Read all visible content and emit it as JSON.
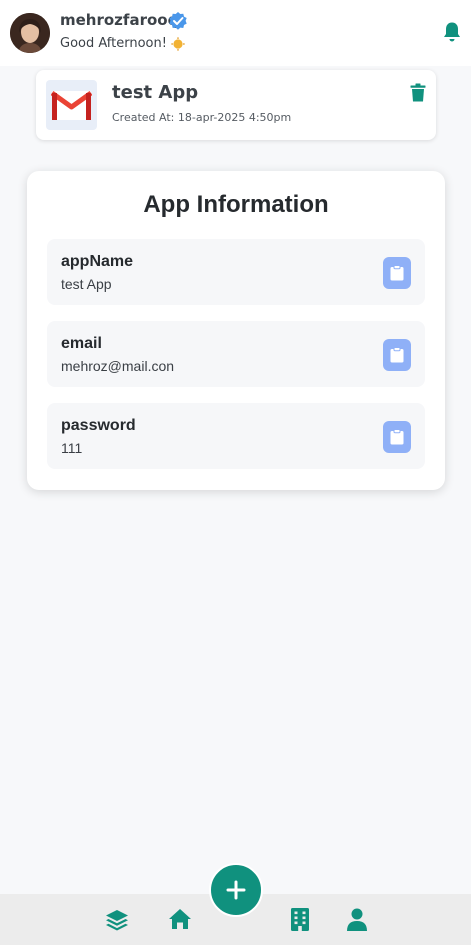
{
  "header": {
    "username": "mehrozfarooq",
    "greeting": "Good Afternoon!",
    "icons": {
      "verified": "verified-badge-icon",
      "weather": "sun-icon",
      "notifications": "bell-icon"
    }
  },
  "app_card": {
    "name": "test App",
    "created": "Created At: 18-apr-2025 4:50pm",
    "logo": "gmail-logo",
    "delete_icon": "trash-icon"
  },
  "info": {
    "title": "App Information",
    "fields": [
      {
        "label": "appName",
        "value": "test App"
      },
      {
        "label": "email",
        "value": "mehroz@mail.con"
      },
      {
        "label": "password",
        "value": "111"
      }
    ],
    "copy_icon": "clipboard-icon"
  },
  "bottom_nav": {
    "items": [
      "layers-icon",
      "home-icon",
      "add-icon",
      "building-icon",
      "profile-icon"
    ]
  },
  "colors": {
    "accent": "#10917e",
    "copy_button": "#8fb0f7",
    "background": "#f7f8fa"
  }
}
